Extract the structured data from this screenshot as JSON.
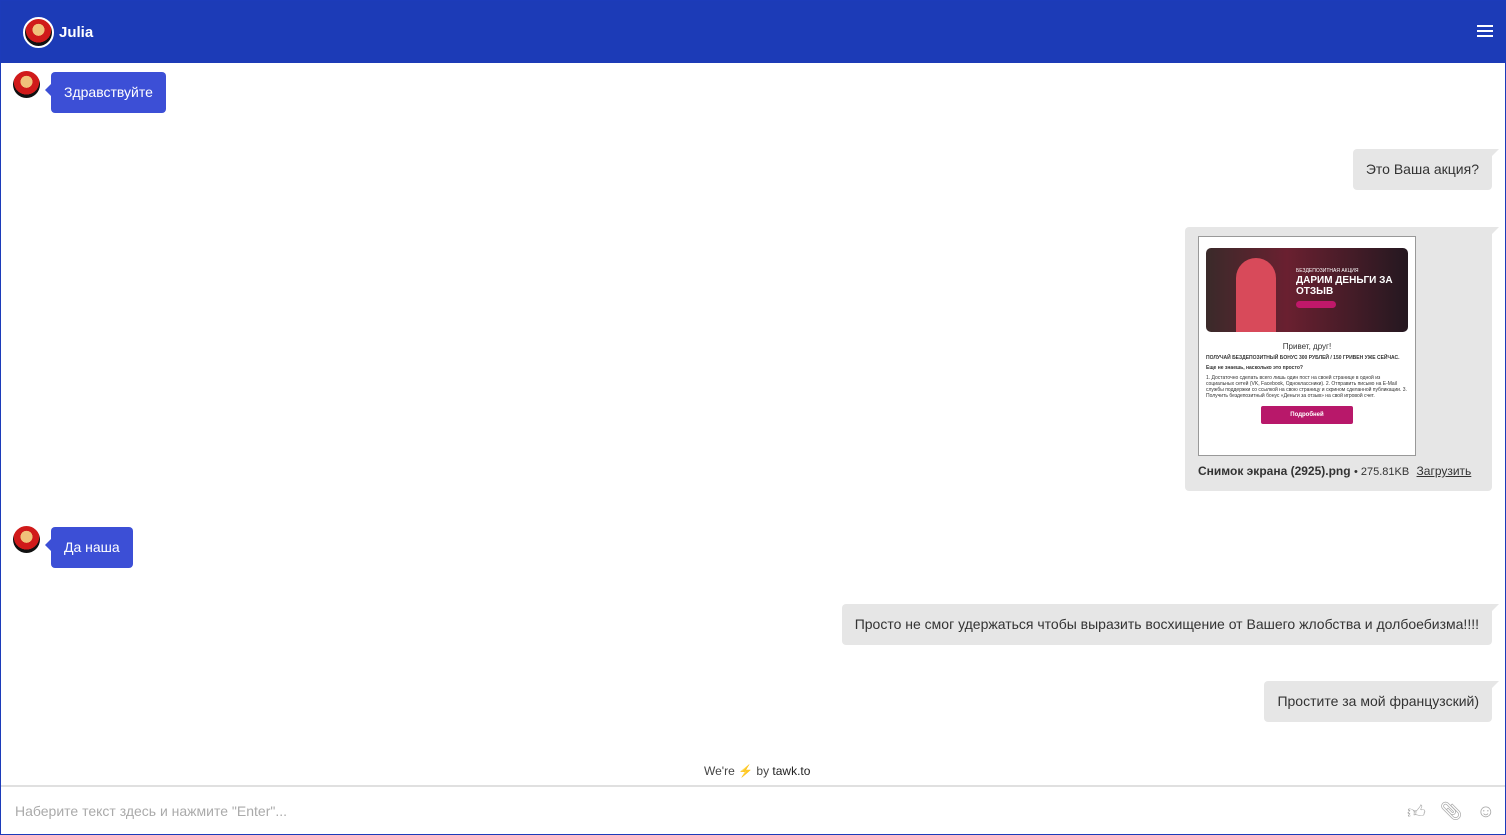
{
  "header": {
    "agent_name": "Julia"
  },
  "messages": [
    {
      "from": "agent",
      "text": "Здравствуйте"
    },
    {
      "from": "visitor",
      "text": "Это Ваша акция?"
    },
    {
      "from": "visitor",
      "type": "file",
      "file_name": "Снимок экрана (2925).png",
      "file_size": "• 275.81KB",
      "download_label": "Загрузить",
      "preview": {
        "banner_small": "БЕЗДЕПОЗИТНАЯ АКЦИЯ",
        "banner_title": "ДАРИМ ДЕНЬГИ ЗА ОТЗЫВ",
        "greeting": "Привет, друг!",
        "headline": "ПОЛУЧАЙ БЕЗДЕПОЗИТНЫЙ БОНУС 300 РУБЛЕЙ / 150 ГРИВЕН УЖЕ СЕЙЧАС.",
        "question": "Еще не знаешь, насколько это просто?",
        "steps": "1. Достаточно сделать всего лишь один пост на своей странице в одной из социальных сетей (VK, Facebook, Одноклассники). 2. Отправить письмо на E-Mail службы поддержки со ссылкой на свою страницу и скрином сделанной публикации. 3. Получить бездепозитный бонус «Деньги за отзыв» на свой игровой счет.",
        "button": "Подробней"
      }
    },
    {
      "from": "agent",
      "text": "Да наша"
    },
    {
      "from": "visitor",
      "text": "Просто не смог удержаться чтобы выразить восхищение от Вашего жлобства и долбоебизма!!!!"
    },
    {
      "from": "visitor",
      "text": "Простите за мой французский)"
    }
  ],
  "footer": {
    "powered_pre": "We're",
    "powered_by": "by",
    "brand": "tawk.to",
    "input_placeholder": "Наберите текст здесь и нажмите \"Enter\"..."
  },
  "colors": {
    "header": "#1c3bb7",
    "agent_bubble": "#3c4fd6",
    "visitor_bubble": "#e6e6e6"
  }
}
